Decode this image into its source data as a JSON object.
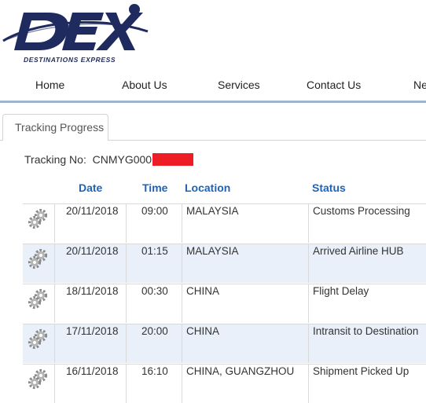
{
  "brand": {
    "tagline": "DESTINATIONS EXPRESS",
    "colors": {
      "navy": "#1f2a5e",
      "accent_blue": "#1e63b8",
      "redaction": "#ee1c25"
    }
  },
  "nav": {
    "items": [
      "Home",
      "About Us",
      "Services",
      "Contact Us",
      "Ne"
    ]
  },
  "tab": {
    "label": "Tracking Progress"
  },
  "tracking": {
    "label": "Tracking No:",
    "number_visible": "CNMYG000"
  },
  "table": {
    "headers": {
      "date": "Date",
      "time": "Time",
      "location": "Location",
      "status": "Status"
    },
    "row_icon": "gears-icon",
    "rows": [
      {
        "date": "20/11/2018",
        "time": "09:00",
        "location": "MALAYSIA",
        "status": "Customs Processing"
      },
      {
        "date": "20/11/2018",
        "time": "01:15",
        "location": "MALAYSIA",
        "status": "Arrived Airline HUB"
      },
      {
        "date": "18/11/2018",
        "time": "00:30",
        "location": "CHINA",
        "status": "Flight Delay"
      },
      {
        "date": "17/11/2018",
        "time": "20:00",
        "location": "CHINA",
        "status": "Intransit to Destination"
      },
      {
        "date": "16/11/2018",
        "time": "16:10",
        "location": "CHINA, GUANGZHOU",
        "status": "Shipment Picked Up"
      }
    ]
  }
}
